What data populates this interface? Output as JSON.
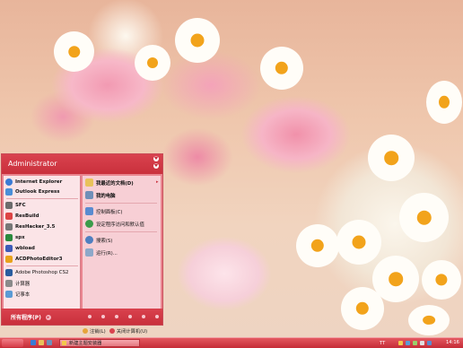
{
  "start_menu": {
    "user_name": "Administrator",
    "pinned": [
      {
        "label": "Internet Explorer",
        "icon": "internet-explorer-icon",
        "bold": true
      },
      {
        "label": "Outlook Express",
        "icon": "outlook-express-icon",
        "bold": true
      }
    ],
    "recent": [
      {
        "label": "SFC",
        "icon": "sfc-icon"
      },
      {
        "label": "ResBuild",
        "icon": "resbuild-icon"
      },
      {
        "label": "ResHacker_3.5",
        "icon": "reshacker-icon"
      },
      {
        "label": "spx",
        "icon": "spx-icon"
      },
      {
        "label": "wbload",
        "icon": "wbload-icon"
      },
      {
        "label": "ACDPhotoEditor3",
        "icon": "acdphotoeditor-icon"
      },
      {
        "label": "Adobe Photoshop CS2",
        "icon": "photoshop-icon"
      },
      {
        "label": "计算器",
        "icon": "calculator-icon"
      },
      {
        "label": "记事本",
        "icon": "notepad-icon"
      }
    ],
    "all_programs": "所有程序(P)",
    "right": [
      {
        "label": "我最近的文档(D)",
        "icon": "recent-documents-icon",
        "bold": true,
        "arrow": "▸"
      },
      {
        "label": "我的电脑",
        "icon": "my-computer-icon",
        "bold": true
      },
      {
        "label": "控制面板(C)",
        "icon": "control-panel-icon"
      },
      {
        "label": "设定程序访问和默认值",
        "icon": "program-access-icon"
      },
      {
        "label": "搜索(S)",
        "icon": "search-icon"
      },
      {
        "label": "运行(R)...",
        "icon": "run-icon"
      }
    ],
    "logoff": "注销(L)",
    "shutdown": "关闭计算机(U)"
  },
  "taskbar": {
    "task_label": "新建主题安装器",
    "tray_text": "TT",
    "clock": "14:16"
  },
  "colors": {
    "menu_header": "#c9303c",
    "menu_body": "#e9858f",
    "left_panel": "#fbe4e7",
    "right_panel": "#f7cfd5",
    "taskbar": "#c52c37"
  }
}
